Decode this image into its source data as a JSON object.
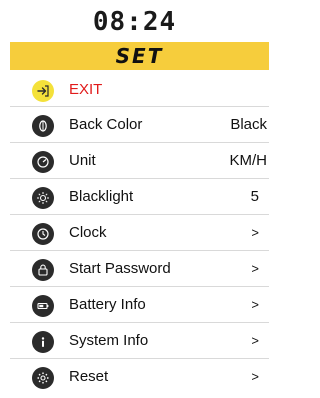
{
  "header": {
    "time": "08:24",
    "title": "SET"
  },
  "menu": {
    "exit": {
      "label": "EXIT",
      "icon": "exit-icon"
    },
    "items": [
      {
        "label": "Back Color",
        "value": "Black",
        "icon": "back-color-icon"
      },
      {
        "label": "Unit",
        "value": "KM/H",
        "icon": "unit-gauge-icon"
      },
      {
        "label": "Blacklight",
        "value": "5",
        "icon": "backlight-sun-icon"
      },
      {
        "label": "Clock",
        "value": ">",
        "icon": "clock-icon"
      },
      {
        "label": "Start Password",
        "value": ">",
        "icon": "lock-icon"
      },
      {
        "label": "Battery Info",
        "value": ">",
        "icon": "battery-icon"
      },
      {
        "label": "System Info",
        "value": ">",
        "icon": "info-icon"
      },
      {
        "label": "Reset",
        "value": ">",
        "icon": "reset-gear-icon"
      }
    ]
  },
  "colors": {
    "accent": "#f6cd3c",
    "exit_text": "#e11b1b",
    "icon_bg": "#2b2b2b",
    "exit_icon_bg": "#f4e13a"
  }
}
